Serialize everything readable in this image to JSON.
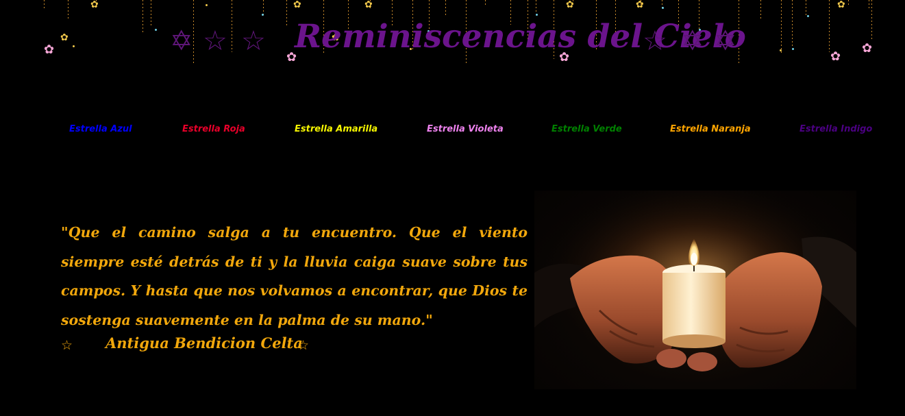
{
  "header": {
    "title": "Reminiscencias del Cielo",
    "title_color": "#6b148c",
    "decor_icons": [
      "hollow-star-icon",
      "hanging-star-icon",
      "pink-flower-star-icon"
    ]
  },
  "nav": {
    "items": [
      {
        "label": "Estrella Azul",
        "color": "#0000ff"
      },
      {
        "label": "Estrella Roja",
        "color": "#e8002a"
      },
      {
        "label": "Estrella Amarilla",
        "color": "#f5f500"
      },
      {
        "label": "Estrella Violeta",
        "color": "#ee82ee"
      },
      {
        "label": "Estrella Verde",
        "color": "#008000"
      },
      {
        "label": "Estrella Naranja",
        "color": "#ffa500"
      },
      {
        "label": "Estrella Indigo",
        "color": "#4b0082"
      }
    ]
  },
  "quote": {
    "text": "\"Que el camino salga a tu encuentro. Que el viento siempre esté detrás de ti y la lluvia caiga suave sobre tus campos. Y hasta que nos volvamos a encontrar, que Dios te sostenga suavemente en la palma de su mano.\"",
    "attribution": "Antigua Bendicion Celta",
    "color": "#f1a70c"
  },
  "image": {
    "subject": "candle-in-hands"
  }
}
